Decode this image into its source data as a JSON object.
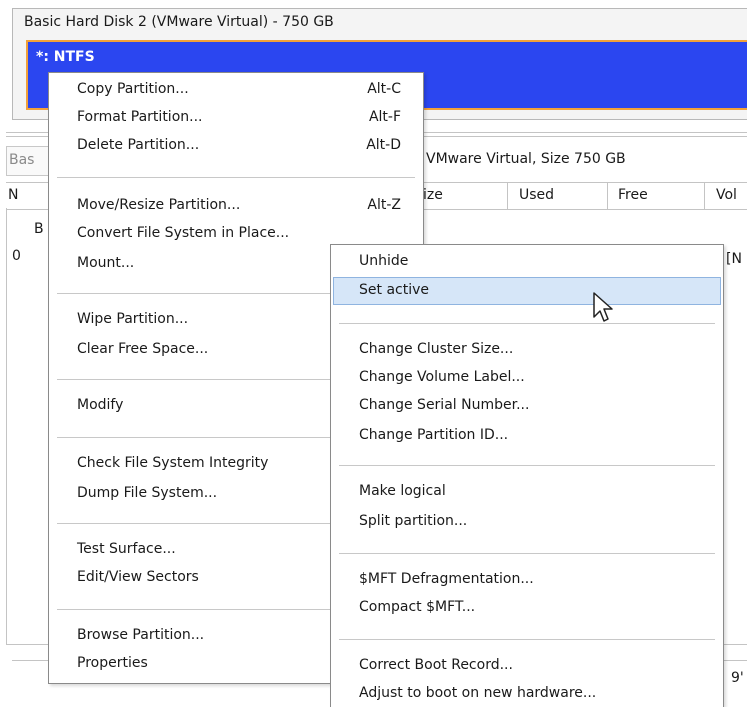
{
  "disk": {
    "title": "Basic Hard Disk 2 (VMware Virtual) - 750 GB",
    "partition_label": "*: NTFS",
    "partition_color": "#2b46f0",
    "partition_border": "#f2a13a"
  },
  "info": {
    "left_partial": "Bas",
    "summary": "VMware Virtual, Size 750 GB"
  },
  "table": {
    "headers": [
      "N",
      "ize",
      "Used",
      "Free",
      "Vol"
    ],
    "row_label_partial": "B",
    "row_value_partial": "0",
    "right_partial": "[N"
  },
  "bottom": {
    "partial_right": "9'"
  },
  "context_menu": {
    "items": [
      {
        "label": "Copy Partition...",
        "shortcut": "Alt-C"
      },
      {
        "label": "Format Partition...",
        "shortcut": "Alt-F"
      },
      {
        "label": "Delete Partition...",
        "shortcut": "Alt-D"
      },
      {
        "label": "Move/Resize Partition...",
        "shortcut": "Alt-Z"
      },
      {
        "label": "Convert File System in Place..."
      },
      {
        "label": "Mount..."
      },
      {
        "label": "Wipe Partition..."
      },
      {
        "label": "Clear Free Space..."
      },
      {
        "label": "Modify"
      },
      {
        "label": "Check File System Integrity"
      },
      {
        "label": "Dump File System..."
      },
      {
        "label": "Test Surface..."
      },
      {
        "label": "Edit/View Sectors"
      },
      {
        "label": "Browse Partition..."
      },
      {
        "label": "Properties"
      }
    ]
  },
  "submenu": {
    "items": [
      {
        "label": "Unhide"
      },
      {
        "label": "Set active",
        "highlighted": true
      },
      {
        "label": "Change Cluster Size..."
      },
      {
        "label": "Change Volume Label..."
      },
      {
        "label": "Change Serial Number..."
      },
      {
        "label": "Change Partition ID..."
      },
      {
        "label": "Make logical"
      },
      {
        "label": "Split partition..."
      },
      {
        "label": "$MFT Defragmentation..."
      },
      {
        "label": "Compact $MFT..."
      },
      {
        "label": "Correct Boot Record..."
      },
      {
        "label": "Adjust to boot on new hardware..."
      }
    ]
  },
  "icons": {
    "cursor": "mouse-pointer-icon"
  },
  "colors": {
    "highlight": "#d6e6f8"
  }
}
